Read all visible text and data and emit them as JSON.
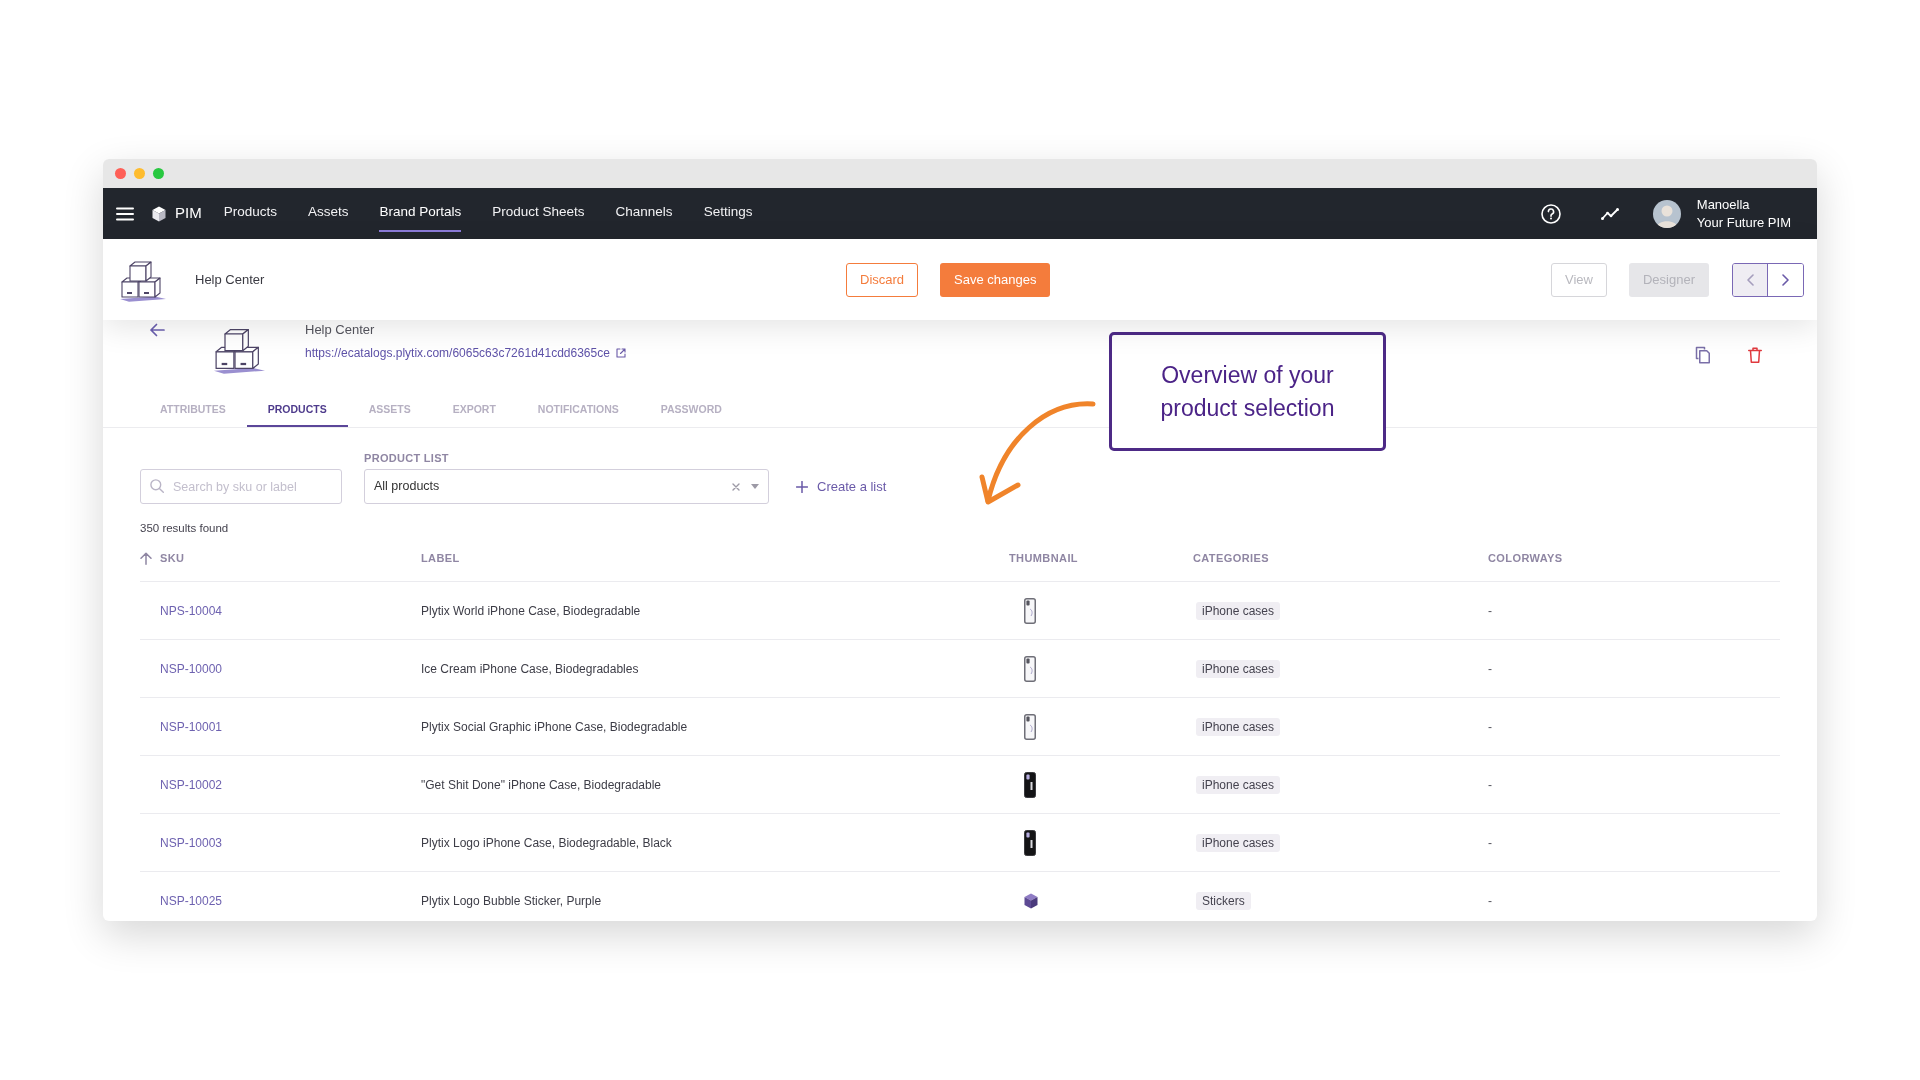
{
  "nav": {
    "brand": "PIM",
    "items": [
      {
        "label": "Products",
        "selected": false
      },
      {
        "label": "Assets",
        "selected": false
      },
      {
        "label": "Brand Portals",
        "selected": true
      },
      {
        "label": "Product Sheets",
        "selected": false
      },
      {
        "label": "Channels",
        "selected": false
      },
      {
        "label": "Settings",
        "selected": false
      }
    ],
    "user": {
      "name": "Manoella",
      "workspace": "Your Future PIM"
    }
  },
  "header": {
    "title": "Help Center",
    "actions": [
      {
        "label": "Discard",
        "kind": "outline",
        "disabled": false
      },
      {
        "label": "Save changes",
        "kind": "solid",
        "disabled": false
      }
    ],
    "modes": [
      {
        "label": "View",
        "kind": "outline",
        "disabled": true
      },
      {
        "label": "Designer",
        "kind": "solid",
        "disabled": true
      }
    ],
    "pager": [
      {
        "kind": "previous",
        "disabled": true
      },
      {
        "kind": "next",
        "disabled": false
      }
    ]
  },
  "portal": {
    "title": "Help Center",
    "url": "https://ecatalogs.plytix.com/6065c63c7261d41cdd6365ce"
  },
  "tabs": [
    {
      "label": "ATTRIBUTES",
      "selected": false
    },
    {
      "label": "PRODUCTS",
      "selected": true
    },
    {
      "label": "ASSETS",
      "selected": false
    },
    {
      "label": "EXPORT",
      "selected": false
    },
    {
      "label": "NOTIFICATIONS",
      "selected": false
    },
    {
      "label": "PASSWORD",
      "selected": false
    }
  ],
  "filters": {
    "search": {
      "placeholder": "Search by sku or label"
    },
    "product_list": {
      "label": "PRODUCT LIST",
      "value": "All products"
    },
    "create_list": "Create a list"
  },
  "results": "350 results found",
  "table": {
    "columns": [
      {
        "label": "SKU",
        "sorted": true
      },
      {
        "label": "LABEL",
        "sorted": false
      },
      {
        "label": "THUMBNAIL",
        "sorted": false
      },
      {
        "label": "CATEGORIES",
        "sorted": false
      },
      {
        "label": "COLORWAYS",
        "sorted": false
      }
    ],
    "rows": [
      {
        "sku": "NPS-10004",
        "label": "Plytix World iPhone Case, Biodegradable",
        "thumbnail": {
          "kind": "light-case"
        },
        "category": "iPhone cases",
        "colorways": "-"
      },
      {
        "sku": "NSP-10000",
        "label": "Ice Cream iPhone Case, Biodegradables",
        "thumbnail": {
          "kind": "light-case"
        },
        "category": "iPhone cases",
        "colorways": "-"
      },
      {
        "sku": "NSP-10001",
        "label": "Plytix Social Graphic iPhone Case, Biodegradable",
        "thumbnail": {
          "kind": "light-case"
        },
        "category": "iPhone cases",
        "colorways": "-"
      },
      {
        "sku": "NSP-10002",
        "label": "\"Get Shit Done\" iPhone Case, Biodegradable",
        "thumbnail": {
          "kind": "dark-case"
        },
        "category": "iPhone cases",
        "colorways": "-"
      },
      {
        "sku": "NSP-10003",
        "label": "Plytix Logo iPhone Case, Biodegradable, Black",
        "thumbnail": {
          "kind": "dark-case"
        },
        "category": "iPhone cases",
        "colorways": "-"
      },
      {
        "sku": "NSP-10025",
        "label": "Plytix Logo Bubble Sticker, Purple",
        "thumbnail": {
          "kind": "sticker"
        },
        "category": "Stickers",
        "colorways": "-"
      }
    ]
  },
  "callout": {
    "text": "Overview of your product selection"
  }
}
